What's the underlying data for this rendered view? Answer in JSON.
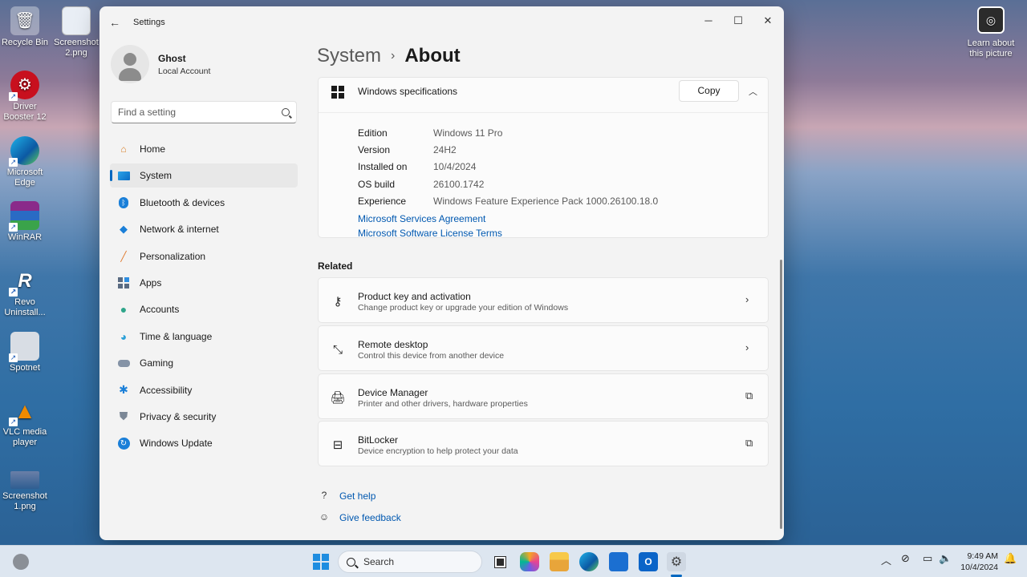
{
  "desktop": {
    "icons": [
      {
        "label": "Recycle Bin",
        "icon": "recycle-bin-icon"
      },
      {
        "label": "Screenshot 2.png",
        "icon": "image-file-icon"
      },
      {
        "label": "Driver Booster 12",
        "icon": "driver-booster-icon"
      },
      {
        "label": "Microsoft Edge",
        "icon": "edge-icon"
      },
      {
        "label": "WinRAR",
        "icon": "winrar-icon"
      },
      {
        "label": "Revo Uninstall...",
        "icon": "revo-uninstaller-icon"
      },
      {
        "label": "Spotnet",
        "icon": "spotnet-icon"
      },
      {
        "label": "VLC media player",
        "icon": "vlc-icon"
      },
      {
        "label": "Screenshot 1.png",
        "icon": "image-file-icon"
      }
    ],
    "learn_label": "Learn about this picture"
  },
  "window": {
    "title": "Settings",
    "controls": {
      "minimize": "─",
      "maximize": "☐",
      "close": "✕"
    }
  },
  "profile": {
    "name": "Ghost",
    "account_type": "Local Account"
  },
  "search": {
    "placeholder": "Find a setting"
  },
  "nav": {
    "items": [
      {
        "label": "Home",
        "icon": "home-icon"
      },
      {
        "label": "System",
        "icon": "system-icon"
      },
      {
        "label": "Bluetooth & devices",
        "icon": "bluetooth-icon"
      },
      {
        "label": "Network & internet",
        "icon": "wifi-icon"
      },
      {
        "label": "Personalization",
        "icon": "brush-icon"
      },
      {
        "label": "Apps",
        "icon": "apps-icon"
      },
      {
        "label": "Accounts",
        "icon": "account-icon"
      },
      {
        "label": "Time & language",
        "icon": "globe-clock-icon"
      },
      {
        "label": "Gaming",
        "icon": "gamepad-icon"
      },
      {
        "label": "Accessibility",
        "icon": "accessibility-icon"
      },
      {
        "label": "Privacy & security",
        "icon": "shield-icon"
      },
      {
        "label": "Windows Update",
        "icon": "update-icon"
      }
    ],
    "active_index": 1
  },
  "breadcrumb": {
    "parent": "System",
    "separator": "›",
    "current": "About"
  },
  "specs": {
    "title": "Windows specifications",
    "copy_label": "Copy",
    "rows": [
      {
        "label": "Edition",
        "value": "Windows 11 Pro"
      },
      {
        "label": "Version",
        "value": "24H2"
      },
      {
        "label": "Installed on",
        "value": "10/4/2024"
      },
      {
        "label": "OS build",
        "value": "26100.1742"
      },
      {
        "label": "Experience",
        "value": "Windows Feature Experience Pack 1000.26100.18.0"
      }
    ],
    "links": [
      "Microsoft Services Agreement",
      "Microsoft Software License Terms"
    ]
  },
  "related": {
    "title": "Related",
    "items": [
      {
        "title": "Product key and activation",
        "desc": "Change product key or upgrade your edition of Windows",
        "icon": "key-icon",
        "action": "chevron-right-icon"
      },
      {
        "title": "Remote desktop",
        "desc": "Control this device from another device",
        "icon": "remote-desktop-icon",
        "action": "chevron-right-icon"
      },
      {
        "title": "Device Manager",
        "desc": "Printer and other drivers, hardware properties",
        "icon": "device-manager-icon",
        "action": "external-link-icon"
      },
      {
        "title": "BitLocker",
        "desc": "Device encryption to help protect your data",
        "icon": "bitlocker-icon",
        "action": "external-link-icon"
      }
    ]
  },
  "help": {
    "get_help": "Get help",
    "give_feedback": "Give feedback"
  },
  "taskbar": {
    "search_label": "Search",
    "clock_time": "9:49 AM",
    "clock_date": "10/4/2024"
  }
}
